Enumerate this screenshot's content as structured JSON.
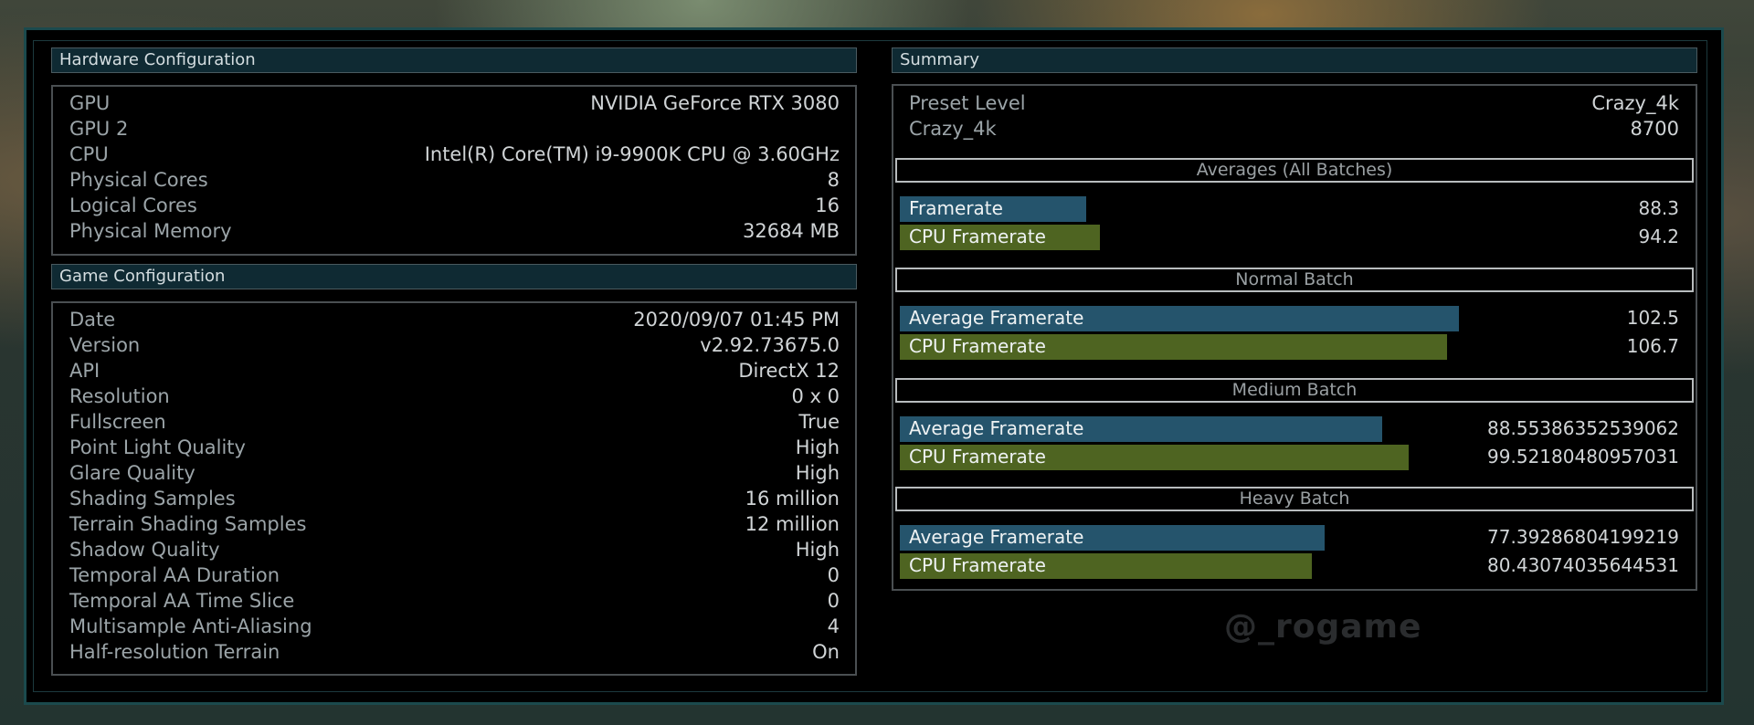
{
  "hardware": {
    "title": "Hardware Configuration",
    "rows": [
      {
        "label": "GPU",
        "value": "NVIDIA GeForce RTX 3080"
      },
      {
        "label": "GPU 2",
        "value": ""
      },
      {
        "label": "CPU",
        "value": "Intel(R) Core(TM) i9-9900K CPU @ 3.60GHz"
      },
      {
        "label": "Physical Cores",
        "value": "8"
      },
      {
        "label": "Logical Cores",
        "value": "16"
      },
      {
        "label": "Physical Memory",
        "value": "32684 MB"
      }
    ]
  },
  "game": {
    "title": "Game Configuration",
    "rows": [
      {
        "label": "Date",
        "value": "2020/09/07 01:45 PM"
      },
      {
        "label": "Version",
        "value": "v2.92.73675.0"
      },
      {
        "label": "API",
        "value": "DirectX 12"
      },
      {
        "label": "Resolution",
        "value": "0 x 0"
      },
      {
        "label": "Fullscreen",
        "value": "True"
      },
      {
        "label": "Point Light Quality",
        "value": "High"
      },
      {
        "label": "Glare Quality",
        "value": "High"
      },
      {
        "label": "Shading Samples",
        "value": "16 million"
      },
      {
        "label": "Terrain Shading Samples",
        "value": "12 million"
      },
      {
        "label": "Shadow Quality",
        "value": "High"
      },
      {
        "label": "Temporal AA Duration",
        "value": "0"
      },
      {
        "label": "Temporal AA Time Slice",
        "value": "0"
      },
      {
        "label": "Multisample Anti-Aliasing",
        "value": "4"
      },
      {
        "label": "Half-resolution Terrain",
        "value": "On"
      }
    ]
  },
  "summary": {
    "title": "Summary",
    "preset_label": "Preset Level",
    "preset_value": "Crazy_4k",
    "score_label": "Crazy_4k",
    "score_value": "8700",
    "sections": [
      {
        "title": "Averages (All Batches)",
        "bars": [
          {
            "label": "Framerate",
            "value": "88.3",
            "fraction": 0.239,
            "color": "#25546c"
          },
          {
            "label": "CPU Framerate",
            "value": "94.2",
            "fraction": 0.257,
            "color": "#4e6421"
          }
        ]
      },
      {
        "title": "Normal Batch",
        "bars": [
          {
            "label": "Average Framerate",
            "value": "102.5",
            "fraction": 0.718,
            "color": "#25546c"
          },
          {
            "label": "CPU Framerate",
            "value": "106.7",
            "fraction": 0.702,
            "color": "#4e6421"
          }
        ]
      },
      {
        "title": "Medium Batch",
        "bars": [
          {
            "label": "Average Framerate",
            "value": "88.55386352539062",
            "fraction": 0.619,
            "color": "#25546c"
          },
          {
            "label": "CPU Framerate",
            "value": "99.52180480957031",
            "fraction": 0.653,
            "color": "#4e6421"
          }
        ]
      },
      {
        "title": "Heavy Batch",
        "bars": [
          {
            "label": "Average Framerate",
            "value": "77.39286804199219",
            "fraction": 0.545,
            "color": "#25546c"
          },
          {
            "label": "CPU Framerate",
            "value": "80.43074035644531",
            "fraction": 0.529,
            "color": "#4e6421"
          }
        ]
      }
    ]
  },
  "watermark": "@_rogame"
}
